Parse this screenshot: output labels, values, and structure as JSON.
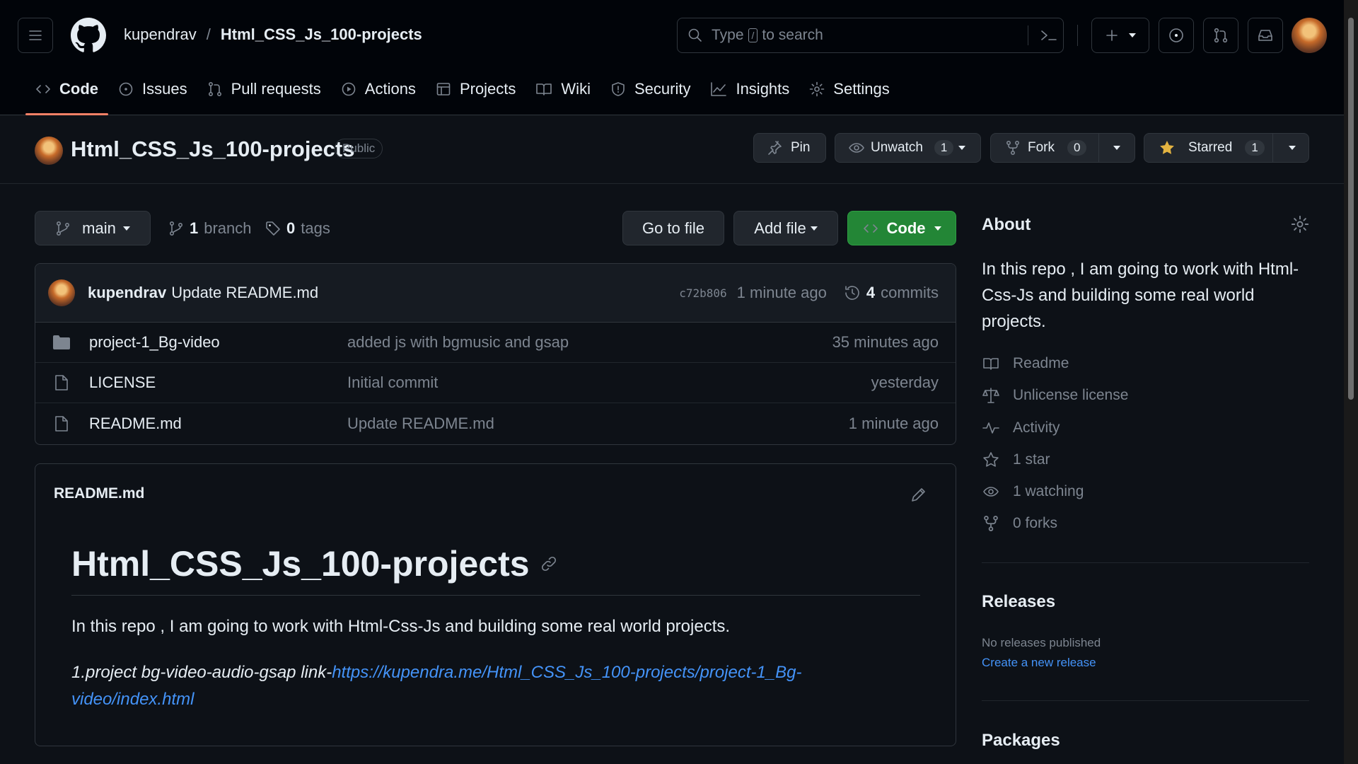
{
  "header": {
    "owner": "kupendrav",
    "separator": "/",
    "repo": "Html_CSS_Js_100-projects",
    "search_prefix": "Type",
    "search_key": "/",
    "search_suffix": "to search"
  },
  "tabs": [
    {
      "label": "Code",
      "icon": "code-icon"
    },
    {
      "label": "Issues",
      "icon": "issue-icon"
    },
    {
      "label": "Pull requests",
      "icon": "pull-request-icon"
    },
    {
      "label": "Actions",
      "icon": "play-icon"
    },
    {
      "label": "Projects",
      "icon": "table-icon"
    },
    {
      "label": "Wiki",
      "icon": "book-icon"
    },
    {
      "label": "Security",
      "icon": "shield-icon"
    },
    {
      "label": "Insights",
      "icon": "graph-icon"
    },
    {
      "label": "Settings",
      "icon": "gear-icon"
    }
  ],
  "repo": {
    "title": "Html_CSS_Js_100-projects",
    "visibility": "Public",
    "pin_label": "Pin",
    "watch_label": "Unwatch",
    "watch_count": "1",
    "fork_label": "Fork",
    "fork_count": "0",
    "star_label": "Starred",
    "star_count": "1"
  },
  "branchbar": {
    "branch": "main",
    "branch_count": "1",
    "branch_word": "branch",
    "tag_count": "0",
    "tag_word": "tags",
    "goto_label": "Go to file",
    "add_label": "Add file",
    "code_label": "Code"
  },
  "commit": {
    "author": "kupendrav",
    "message": "Update README.md",
    "sha": "c72b806",
    "time": "1 minute ago",
    "count": "4",
    "count_word": "commits"
  },
  "files": [
    {
      "type": "folder",
      "name": "project-1_Bg-video",
      "message": "added js with bgmusic and gsap",
      "time": "35 minutes ago"
    },
    {
      "type": "file",
      "name": "LICENSE",
      "message": "Initial commit",
      "time": "yesterday"
    },
    {
      "type": "file",
      "name": "README.md",
      "message": "Update README.md",
      "time": "1 minute ago"
    }
  ],
  "readme": {
    "header": "README.md",
    "title": "Html_CSS_Js_100-projects",
    "paragraph": "In this repo , I am going to work with Html-Css-Js and building some real world projects.",
    "project_prefix": "1.project bg-video-audio-gsap link-",
    "project_link": "https://kupendra.me/Html_CSS_Js_100-projects/project-1_Bg-video/index.html"
  },
  "about": {
    "heading": "About",
    "description": "In this repo , I am going to work with Html-Css-Js and building some real world projects.",
    "items": [
      {
        "label": "Readme",
        "icon": "book-icon"
      },
      {
        "label": "Unlicense license",
        "icon": "law-icon"
      },
      {
        "label": "Activity",
        "icon": "pulse-icon"
      },
      {
        "label": "1 star",
        "icon": "star-icon"
      },
      {
        "label": "1 watching",
        "icon": "eye-icon"
      },
      {
        "label": "0 forks",
        "icon": "fork-icon"
      }
    ]
  },
  "releases": {
    "heading": "Releases",
    "none": "No releases published",
    "create": "Create a new release"
  },
  "packages": {
    "heading": "Packages"
  },
  "colors": {
    "background": "#0d1117",
    "header": "#010409",
    "accent_tab": "#f78166",
    "code_button": "#238636",
    "link": "#4493f8",
    "star": "#e3b341"
  }
}
